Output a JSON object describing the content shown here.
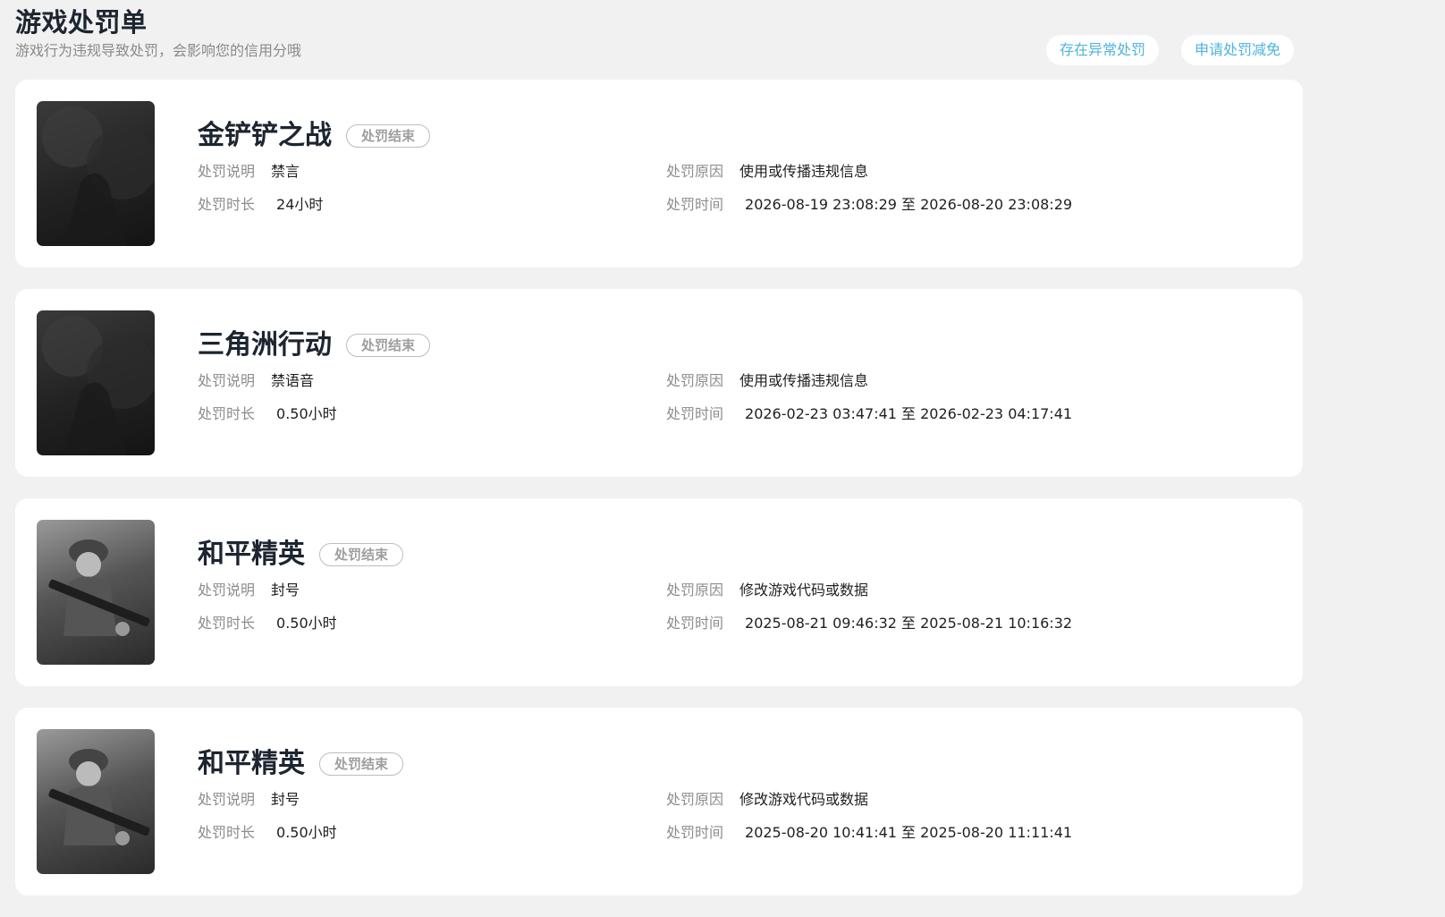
{
  "page": {
    "title": "游戏处罚单",
    "subtitle": "游戏行为违规导致处罚，会影响您的信用分哦"
  },
  "actions": {
    "abnormal_label": "存在异常处罚",
    "appeal_label": "申请处罚减免"
  },
  "labels": {
    "desc": "处罚说明",
    "duration": "处罚时长",
    "reason": "处罚原因",
    "time": "处罚时间"
  },
  "records": [
    {
      "game": "金铲铲之战",
      "status": "处罚结束",
      "desc": "禁言",
      "duration": "24小时",
      "reason": "使用或传播违规信息",
      "time": "2026-08-19 23:08:29 至 2026-08-20 23:08:29"
    },
    {
      "game": "三角洲行动",
      "status": "处罚结束",
      "desc": "禁语音",
      "duration": "0.50小时",
      "reason": "使用或传播违规信息",
      "time": "2026-02-23 03:47:41 至 2026-02-23 04:17:41"
    },
    {
      "game": "和平精英",
      "status": "处罚结束",
      "desc": "封号",
      "duration": "0.50小时",
      "reason": "修改游戏代码或数据",
      "time": "2025-08-21 09:46:32 至 2025-08-21 10:16:32"
    },
    {
      "game": "和平精英",
      "status": "处罚结束",
      "desc": "封号",
      "duration": "0.50小时",
      "reason": "修改游戏代码或数据",
      "time": "2025-08-20 10:41:41 至 2025-08-20 11:11:41"
    }
  ]
}
